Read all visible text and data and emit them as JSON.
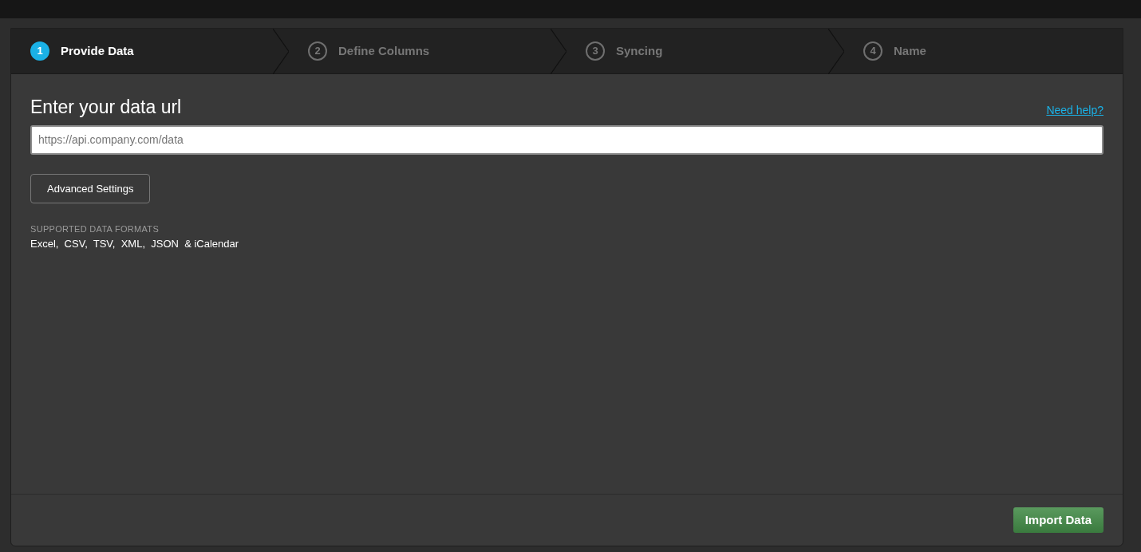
{
  "steps": [
    {
      "number": "1",
      "label": "Provide Data",
      "selected": true
    },
    {
      "number": "2",
      "label": "Define Columns",
      "selected": false
    },
    {
      "number": "3",
      "label": "Syncing",
      "selected": false
    },
    {
      "number": "4",
      "label": "Name",
      "selected": false
    }
  ],
  "heading": "Enter your data url",
  "help_link": "Need help?",
  "url_field": {
    "placeholder": "https://api.company.com/data"
  },
  "advanced_button": "Advanced Settings",
  "formats": {
    "caption": "SUPPORTED DATA FORMATS",
    "list": "Excel,  CSV,  TSV,  XML,  JSON  & iCalendar"
  },
  "primary_button": "Import Data"
}
